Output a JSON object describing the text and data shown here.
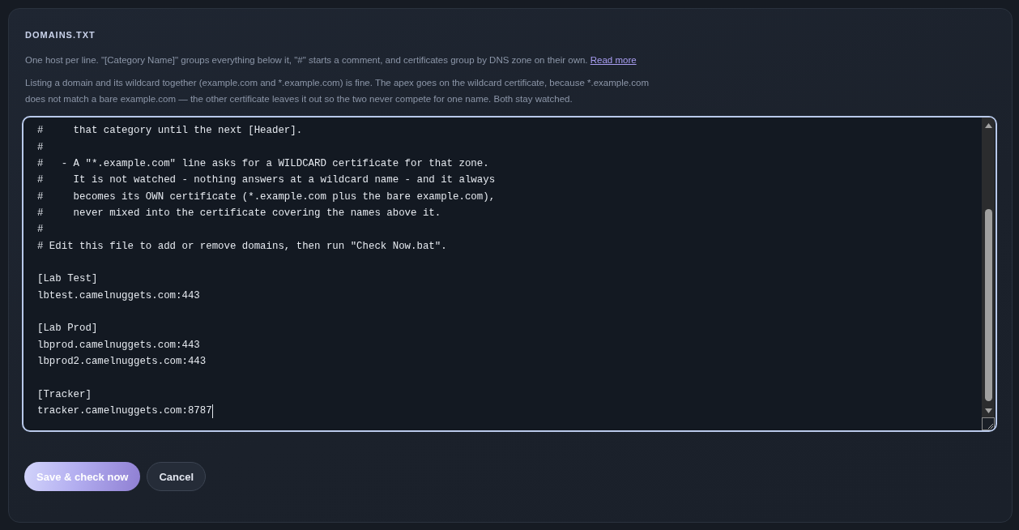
{
  "panel": {
    "title": "DOMAINS.TXT",
    "intro": "One host per line. \"[Category Name]\" groups everything below it, \"#\" starts a comment, and certificates group by DNS zone on their own.",
    "read_more_link": "Read more",
    "note": "Listing a domain and its wildcard together (example.com and *.example.com) is fine. The apex goes on the wildcard certificate, because *.example.com does not match a bare example.com — the other certificate leaves it out so the two never compete for one name. Both stay watched."
  },
  "editor": {
    "focused": true,
    "comment_lines": [
      "#     that category until the next [Header].",
      "#",
      "#   - A \"*.example.com\" line asks for a WILDCARD certificate for that zone.",
      "#     It is not watched - nothing answers at a wildcard name - and it always",
      "#     becomes its OWN certificate (*.example.com plus the bare example.com),",
      "#     never mixed into the certificate covering the names above it.",
      "#",
      "# Edit this file to add or remove domains, then run \"Check Now.bat\"."
    ],
    "sections": [
      {
        "header": "[Lab Test]",
        "hosts": [
          "lbtest.camelnuggets.com:443"
        ]
      },
      {
        "header": "[Lab Prod]",
        "hosts": [
          "lbprod.camelnuggets.com:443",
          "lbprod2.camelnuggets.com:443"
        ]
      },
      {
        "header": "[Tracker]",
        "hosts": [
          "tracker.camelnuggets.com:8787"
        ]
      }
    ]
  },
  "buttons": [
    {
      "label": "Save & check now",
      "kind": "primary"
    },
    {
      "label": "Cancel",
      "kind": "secondary"
    }
  ]
}
